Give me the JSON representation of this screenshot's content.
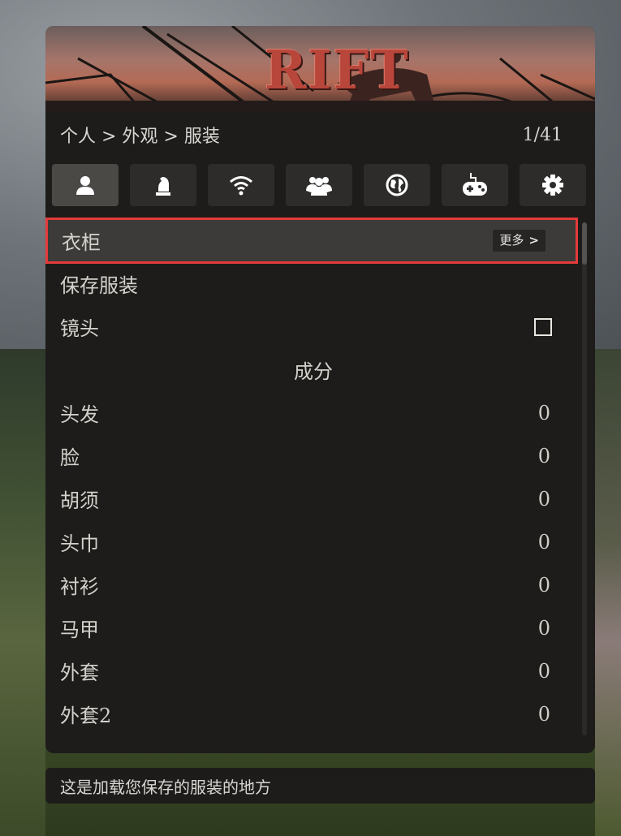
{
  "banner": {
    "logo_text": "RIFT"
  },
  "header": {
    "breadcrumb": "个人 > 外观 > 服装",
    "page_counter": "1/41"
  },
  "tabs": [
    {
      "icon": "person-icon",
      "active": true
    },
    {
      "icon": "chess-knight-icon",
      "active": false
    },
    {
      "icon": "wifi-icon",
      "active": false
    },
    {
      "icon": "group-icon",
      "active": false
    },
    {
      "icon": "globe-icon",
      "active": false
    },
    {
      "icon": "gamepad-icon",
      "active": false
    },
    {
      "icon": "gear-icon",
      "active": false
    }
  ],
  "menu": {
    "wardrobe": {
      "label": "衣柜",
      "more": "更多",
      "more_arrow": ">"
    },
    "save_outfit": {
      "label": "保存服装"
    },
    "camera": {
      "label": "镜头",
      "checked": false
    },
    "section_header": "成分",
    "components": [
      {
        "label": "头发",
        "value": "0"
      },
      {
        "label": "脸",
        "value": "0"
      },
      {
        "label": "胡须",
        "value": "0"
      },
      {
        "label": "头巾",
        "value": "0"
      },
      {
        "label": "衬衫",
        "value": "0"
      },
      {
        "label": "马甲",
        "value": "0"
      },
      {
        "label": "外套",
        "value": "0"
      },
      {
        "label": "外套2",
        "value": "0"
      }
    ]
  },
  "description": "这是加载您保存的服装的地方",
  "colors": {
    "highlight": "#e43a3a",
    "panel": "#1d1c1a",
    "logo": "#b8463b"
  }
}
